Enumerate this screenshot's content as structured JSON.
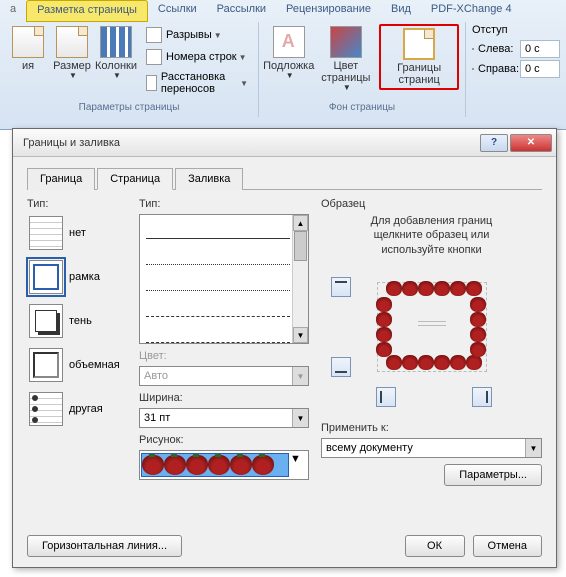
{
  "ribbon": {
    "tabs": {
      "layout": "Разметка страницы",
      "links": "Ссылки",
      "mailings": "Рассылки",
      "review": "Рецензирование",
      "view": "Вид",
      "pdf": "PDF-XChange 4"
    },
    "buttons": {
      "orientation": "ия",
      "size": "Размер",
      "columns": "Колонки",
      "breaks": "Разрывы",
      "lineNumbers": "Номера строк",
      "hyphenation": "Расстановка переносов",
      "watermark": "Подложка",
      "pageColor": "Цвет страницы",
      "pageBorders": "Границы страниц"
    },
    "groups": {
      "pageSetup": "Параметры страницы",
      "pageBackground": "Фон страницы"
    },
    "indent": {
      "title": "Отступ",
      "left": "Слева:",
      "right": "Справа:",
      "leftVal": "0 с",
      "rightVal": "0 с"
    }
  },
  "dialog": {
    "title": "Границы и заливка",
    "tabs": {
      "border": "Граница",
      "page": "Страница",
      "shading": "Заливка"
    },
    "labels": {
      "type": "Тип:",
      "style": "Тип:",
      "color": "Цвет:",
      "width": "Ширина:",
      "art": "Рисунок:",
      "preview": "Образец",
      "applyTo": "Применить к:"
    },
    "types": {
      "none": "нет",
      "box": "рамка",
      "shadow": "тень",
      "threeD": "объемная",
      "custom": "другая"
    },
    "values": {
      "color": "Авто",
      "width": "31 пт",
      "applyTo": "всему документу"
    },
    "previewHint1": "Для добавления границ",
    "previewHint2": "щелкните образец или",
    "previewHint3": "используйте кнопки",
    "buttons": {
      "params": "Параметры...",
      "hline": "Горизонтальная линия...",
      "ok": "ОК",
      "cancel": "Отмена"
    }
  }
}
